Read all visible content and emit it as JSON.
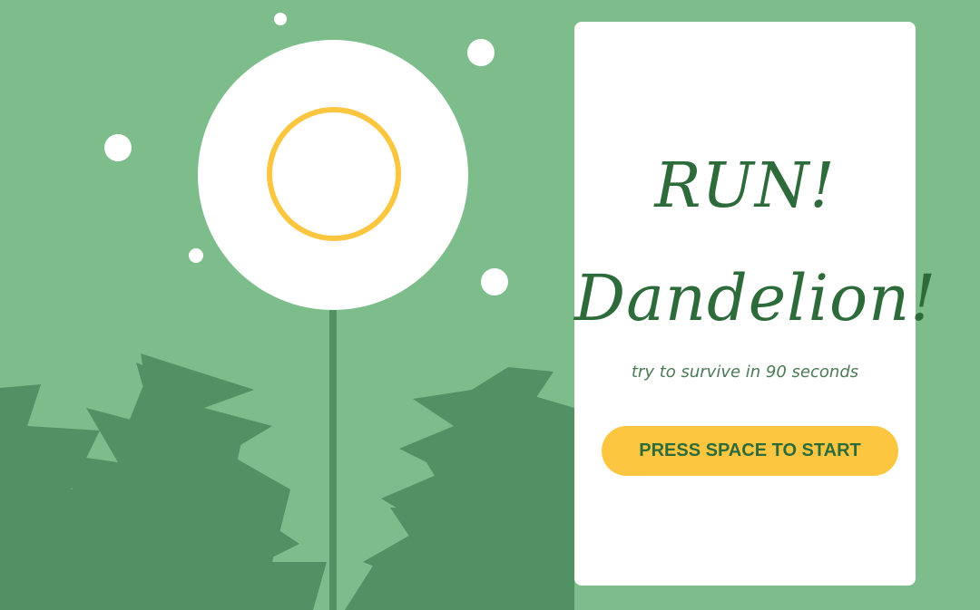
{
  "title": {
    "line1": "RUN!",
    "line2": "Dandelion!"
  },
  "subtitle": "try to survive in 90 seconds",
  "start_button": {
    "label": "PRESS SPACE TO START"
  },
  "colors": {
    "background": "#7dbd8c",
    "leaf": "#519163",
    "stem": "#519163",
    "flower_head": "#ffffff",
    "sun_ring": "#fdc640",
    "card": "#ffffff",
    "title_text": "#2e6b3a",
    "button": "#fdc640"
  }
}
